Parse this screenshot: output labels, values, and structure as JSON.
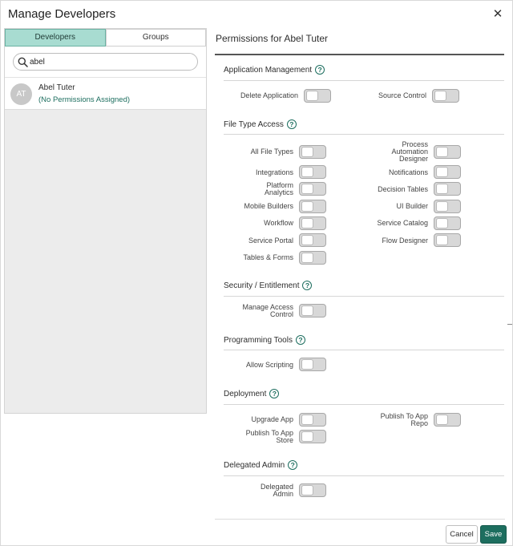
{
  "dialog": {
    "title": "Manage Developers"
  },
  "left": {
    "tabs": [
      {
        "label": "Developers",
        "active": true
      },
      {
        "label": "Groups",
        "active": false
      }
    ],
    "search": {
      "value": "abel",
      "placeholder": ""
    },
    "results": [
      {
        "initials": "AT",
        "name": "Abel Tuter",
        "subtitle": "(No Permissions Assigned)"
      }
    ]
  },
  "right": {
    "title": "Permissions for Abel Tuter",
    "sections": {
      "app_mgmt": {
        "title": "Application Management",
        "items": [
          {
            "label": "Delete Application",
            "on": false
          },
          {
            "label": "Source Control",
            "on": false
          }
        ]
      },
      "file_type": {
        "title": "File Type Access",
        "items": [
          {
            "label": "All File Types",
            "on": false
          },
          {
            "label": "Process Automation Designer",
            "lines": [
              "Process",
              "Automation",
              "Designer"
            ],
            "on": false
          },
          {
            "label": "Integrations",
            "on": false
          },
          {
            "label": "Notifications",
            "on": false
          },
          {
            "label": "Platform Analytics",
            "lines": [
              "Platform",
              "Analytics"
            ],
            "on": false
          },
          {
            "label": "Decision Tables",
            "on": false
          },
          {
            "label": "Mobile Builders",
            "on": false
          },
          {
            "label": "UI Builder",
            "on": false
          },
          {
            "label": "Workflow",
            "on": false
          },
          {
            "label": "Service Catalog",
            "on": false
          },
          {
            "label": "Service Portal",
            "on": false
          },
          {
            "label": "Flow Designer",
            "on": false
          },
          {
            "label": "Tables & Forms",
            "on": false
          }
        ]
      },
      "security": {
        "title": "Security / Entitlement",
        "items": [
          {
            "label": "Manage Access Control",
            "lines": [
              "Manage Access",
              "Control"
            ],
            "on": false
          }
        ]
      },
      "programming": {
        "title": "Programming Tools",
        "items": [
          {
            "label": "Allow Scripting",
            "on": false
          }
        ]
      },
      "deployment": {
        "title": "Deployment",
        "items": [
          {
            "label": "Upgrade App",
            "on": false
          },
          {
            "label": "Publish To App Repo",
            "lines": [
              "Publish To App",
              "Repo"
            ],
            "on": false
          },
          {
            "label": "Publish To App Store",
            "lines": [
              "Publish To App",
              "Store"
            ],
            "on": false
          }
        ]
      },
      "delegated": {
        "title": "Delegated Admin",
        "items": [
          {
            "label": "Delegated Admin",
            "lines": [
              "Delegated",
              "Admin"
            ],
            "on": false
          }
        ]
      }
    }
  },
  "footer": {
    "cancel_label": "Cancel",
    "save_label": "Save"
  },
  "colors": {
    "accent": "#1d6e5f",
    "tab_active": "#a8dcd1",
    "panel_bg": "#ececec"
  }
}
